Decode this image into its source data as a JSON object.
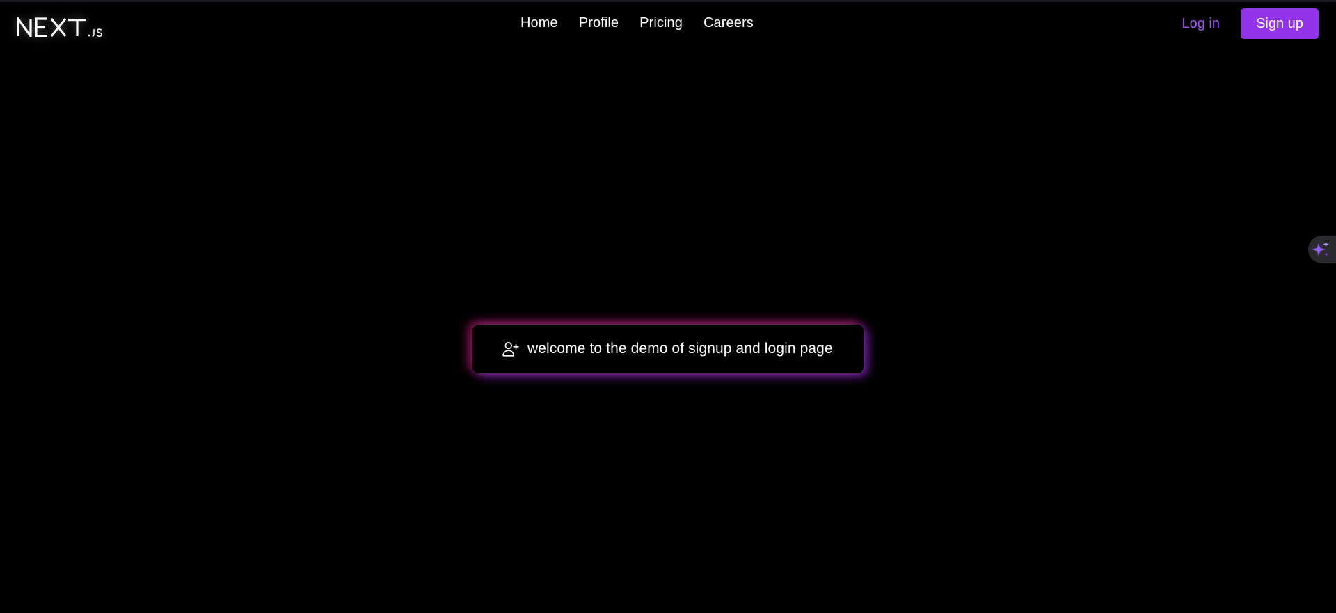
{
  "navbar": {
    "logo": {
      "main": "NEXT",
      "suffix": ".JS",
      "icon": "nextjs-logo"
    },
    "links": [
      {
        "label": "Home"
      },
      {
        "label": "Profile"
      },
      {
        "label": "Pricing"
      },
      {
        "label": "Careers"
      }
    ],
    "login_label": "Log in",
    "signup_label": "Sign up"
  },
  "hero": {
    "icon": "user-plus-icon",
    "text": "welcome to the demo of signup and login page"
  },
  "assistant_tab": {
    "icon": "sparkle-icon"
  },
  "colors": {
    "background": "#000000",
    "accent": "#9333ea",
    "accent_text": "#a855f7",
    "glow_pink": "#db2777",
    "glow_purple": "#9333ea",
    "text": "#ffffff"
  }
}
